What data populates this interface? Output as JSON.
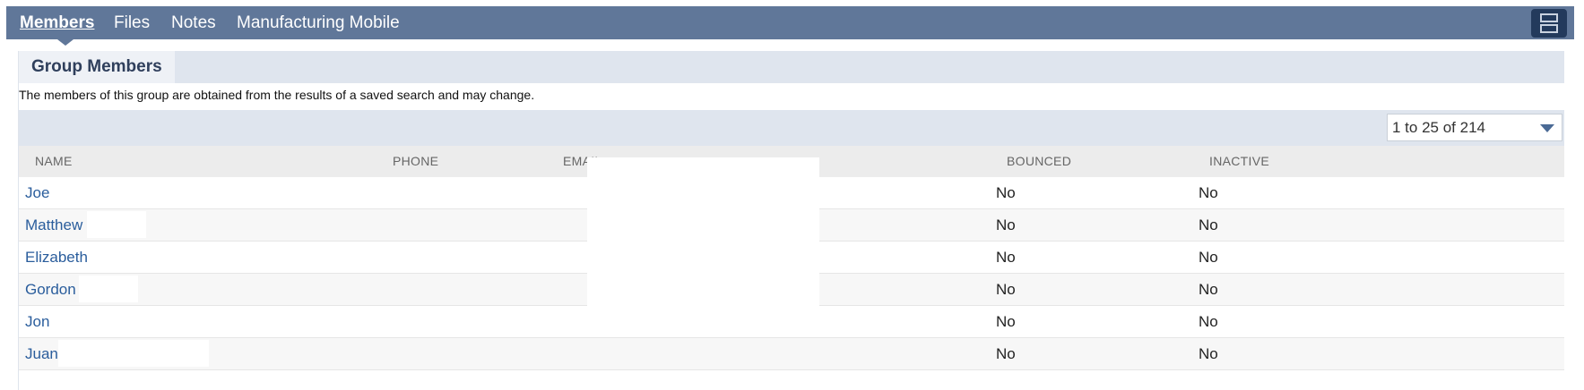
{
  "tabs": [
    {
      "label": "Members",
      "active": true
    },
    {
      "label": "Files",
      "active": false
    },
    {
      "label": "Notes",
      "active": false
    },
    {
      "label": "Manufacturing Mobile",
      "active": false
    }
  ],
  "section": {
    "title": "Group Members",
    "description": "The members of this group are obtained from the results of a saved search and may change."
  },
  "pager": {
    "label": "1 to 25 of 214"
  },
  "columns": [
    "NAME",
    "PHONE",
    "EMAIL",
    "BOUNCED",
    "INACTIVE"
  ],
  "rows": [
    {
      "name": "Joe",
      "bounced": "No",
      "inactive": "No"
    },
    {
      "name": "Matthew",
      "bounced": "No",
      "inactive": "No"
    },
    {
      "name": "Elizabeth",
      "bounced": "No",
      "inactive": "No"
    },
    {
      "name": "Gordon",
      "bounced": "No",
      "inactive": "No"
    },
    {
      "name": "Jon",
      "bounced": "No",
      "inactive": "No"
    },
    {
      "name": "Juan",
      "bounced": "No",
      "inactive": "No"
    }
  ],
  "colors": {
    "tabbar": "#607799",
    "link": "#2a5d9c",
    "header_band": "#dfe5ee"
  },
  "icons": {
    "menu": "layout-toggle-icon",
    "pager": "chevron-down-icon"
  }
}
